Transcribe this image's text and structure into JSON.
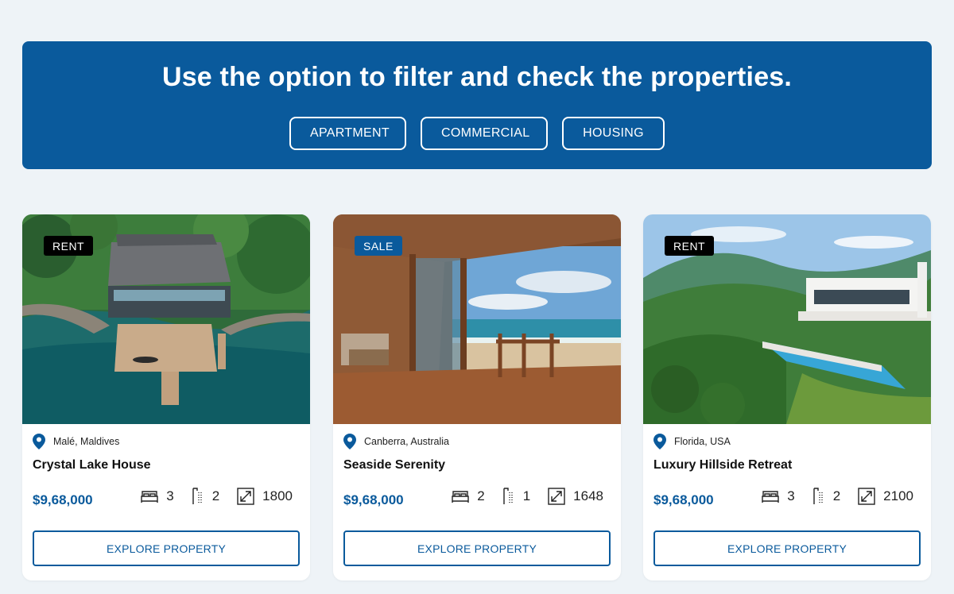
{
  "banner": {
    "heading": "Use the option to filter and check the properties.",
    "filters": [
      "APARTMENT",
      "COMMERCIAL",
      "HOUSING"
    ]
  },
  "colors": {
    "brand_blue": "#0a5a9c",
    "page_bg": "#eef3f7",
    "rent_badge": "#000000",
    "sale_badge": "#0a5a9c"
  },
  "properties": [
    {
      "badge": "RENT",
      "location": "Malé, Maldives",
      "title": "Crystal Lake House",
      "price": "$9,68,000",
      "beds": "3",
      "baths": "2",
      "area": "1800",
      "cta": "EXPLORE PROPERTY",
      "image": "lake-house-aerial"
    },
    {
      "badge": "SALE",
      "location": "Canberra, Australia",
      "title": "Seaside Serenity",
      "price": "$9,68,000",
      "beds": "2",
      "baths": "1",
      "area": "1648",
      "cta": "EXPLORE PROPERTY",
      "image": "beach-deck"
    },
    {
      "badge": "RENT",
      "location": "Florida, USA",
      "title": "Luxury Hillside Retreat",
      "price": "$9,68,000",
      "beds": "3",
      "baths": "2",
      "area": "2100",
      "cta": "EXPLORE PROPERTY",
      "image": "hillside-villa"
    }
  ],
  "icons": {
    "location": "map-pin-icon",
    "beds": "bed-icon",
    "baths": "shower-icon",
    "area": "area-expand-icon"
  }
}
